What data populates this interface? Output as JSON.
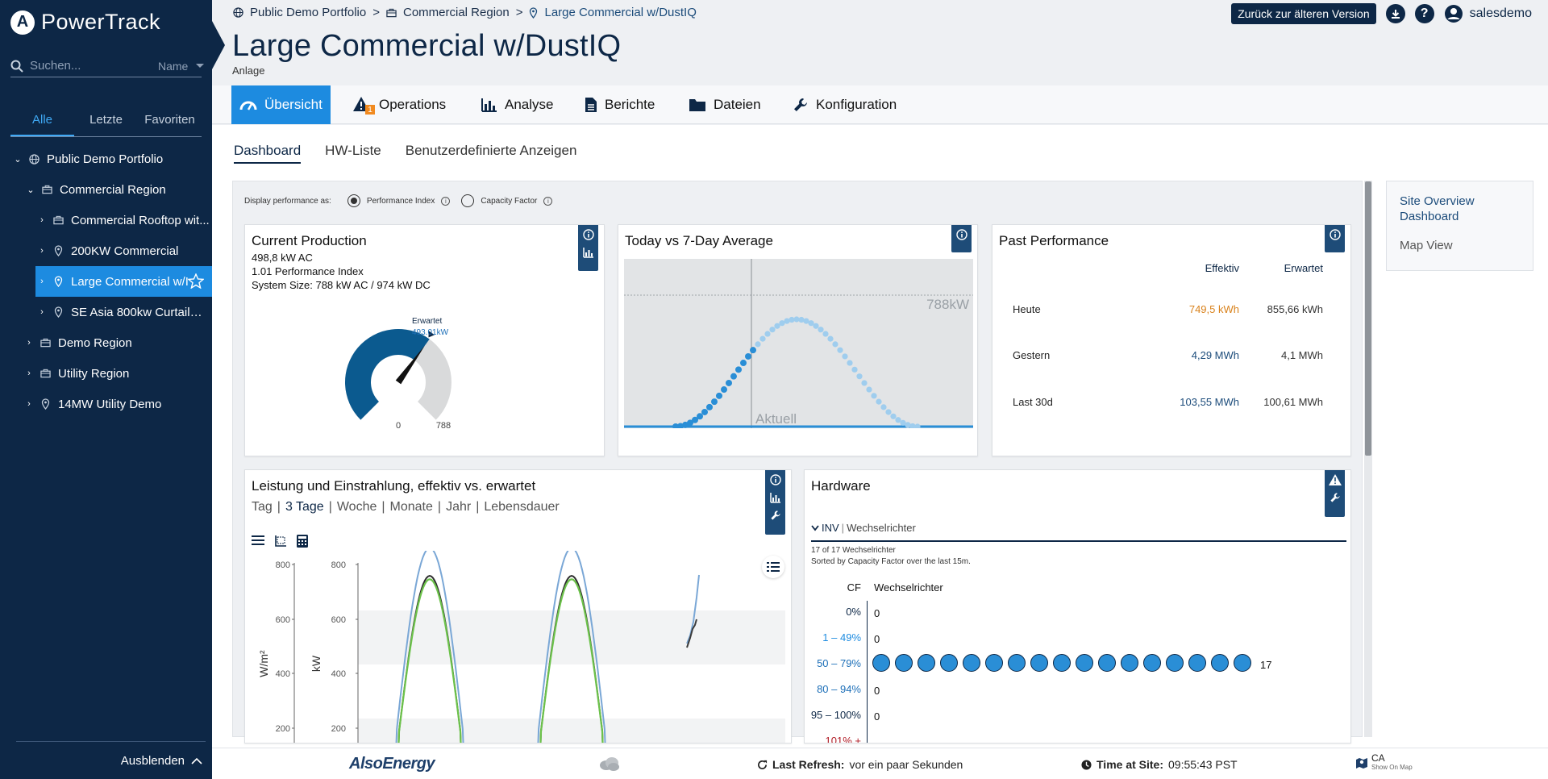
{
  "app": {
    "name": "PowerTrack"
  },
  "sidebar": {
    "search_placeholder": "Suchen...",
    "sort_label": "Name",
    "tabs": [
      "Alle",
      "Letzte",
      "Favoriten"
    ],
    "tree": [
      {
        "label": "Public Demo Portfolio"
      },
      {
        "label": "Commercial Region"
      },
      {
        "label": "Commercial Rooftop wit..."
      },
      {
        "label": "200KW Commercial"
      },
      {
        "label": "Large Commercial w/I"
      },
      {
        "label": "SE Asia 800kw Curtailme..."
      },
      {
        "label": "Demo Region"
      },
      {
        "label": "Utility Region"
      },
      {
        "label": "14MW Utility Demo"
      }
    ],
    "collapse_label": "Ausblenden"
  },
  "header": {
    "breadcrumb": [
      "Public Demo Portfolio",
      "Commercial Region",
      "Large Commercial w/DustIQ"
    ],
    "old_version_button": "Zurück zur älteren Version",
    "username": "salesdemo",
    "title": "Large Commercial w/DustIQ",
    "subtitle": "Anlage"
  },
  "mainnav": {
    "tabs": [
      "Übersicht",
      "Operations",
      "Analyse",
      "Berichte",
      "Dateien",
      "Konfiguration"
    ],
    "operations_badge": "1"
  },
  "subtabs": [
    "Dashboard",
    "HW-Liste",
    "Benutzerdefinierte Anzeigen"
  ],
  "perf_toggle": {
    "label": "Display performance as:",
    "option1": "Performance Index",
    "option2": "Capacity Factor"
  },
  "current_production": {
    "title": "Current Production",
    "line1": "498,8 kW AC",
    "line2": "1.01 Performance Index",
    "line3": "System Size: 788 kW AC / 974 kW DC",
    "gauge_expected_label": "Erwartet",
    "gauge_expected_value": "493.01kW",
    "gauge_min": "0",
    "gauge_max": "788",
    "gauge_fraction": 0.633,
    "expected_fraction": 0.626
  },
  "today_vs_avg": {
    "title": "Today vs 7-Day Average",
    "max_label": "788kW",
    "now_label": "Aktuell"
  },
  "past_performance": {
    "title": "Past Performance",
    "col_actual": "Effektiv",
    "col_expected": "Erwartet",
    "rows": [
      {
        "label": "Heute",
        "actual": "749,5 kWh",
        "expected": "855,66 kWh"
      },
      {
        "label": "Gestern",
        "actual": "4,29 MWh",
        "expected": "4,1 MWh"
      },
      {
        "label": "Last 30d",
        "actual": "103,55 MWh",
        "expected": "100,61 MWh"
      }
    ]
  },
  "power_chart": {
    "title": "Leistung und Einstrahlung, effektiv vs. erwartet",
    "ranges": [
      "Tag",
      "3 Tage",
      "Woche",
      "Monate",
      "Jahr",
      "Lebensdauer"
    ],
    "active_range": "3 Tage",
    "left_axis_label": "W/m²",
    "right_axis_label": "kW",
    "left_ticks": [
      "800",
      "600",
      "400",
      "200"
    ],
    "right_ticks": [
      "800",
      "600",
      "400",
      "200"
    ]
  },
  "hardware": {
    "title": "Hardware",
    "group_code": "INV",
    "group_name": "Wechselrichter",
    "count_text": "17 of 17 Wechselrichter",
    "sort_text": "Sorted by Capacity Factor over the last 15m.",
    "col_cf": "CF",
    "col_name": "Wechselrichter",
    "rows": [
      {
        "range": "0%",
        "count": "0"
      },
      {
        "range": "1 – 49%",
        "count": "0"
      },
      {
        "range": "50 – 79%",
        "count": "17"
      },
      {
        "range": "80 – 94%",
        "count": "0"
      },
      {
        "range": "95 – 100%",
        "count": "0"
      },
      {
        "range": "101% +",
        "count": ""
      }
    ]
  },
  "side_links": {
    "link1": "Site Overview Dashboard",
    "link2": "Map View"
  },
  "footer": {
    "brand": "AlsoEnergy",
    "refresh_label": "Last Refresh:",
    "refresh_value": "vor ein paar Sekunden",
    "time_label": "Time at Site:",
    "time_value": "09:55:43 PST",
    "region": "CA",
    "map_link": "Show On Map"
  },
  "colors": {
    "sidebar": "#0d2746",
    "accent": "#1d8be0",
    "gauge": "#0b5a8f",
    "orange": "#d9821c"
  }
}
